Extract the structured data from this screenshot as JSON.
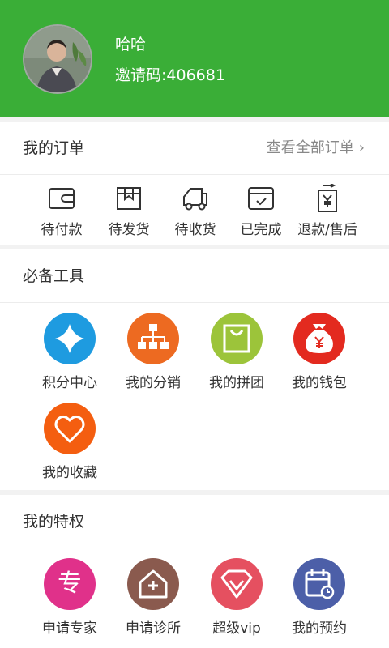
{
  "user": {
    "name": "哈哈",
    "invite_text": "邀请码:406681"
  },
  "orders": {
    "title": "我的订单",
    "view_all": "查看全部订单",
    "items": [
      {
        "label": "待付款",
        "icon": "wallet-icon"
      },
      {
        "label": "待发货",
        "icon": "package-icon"
      },
      {
        "label": "待收货",
        "icon": "truck-icon"
      },
      {
        "label": "已完成",
        "icon": "completed-icon"
      },
      {
        "label": "退款/售后",
        "icon": "refund-icon"
      }
    ]
  },
  "tools": {
    "title": "必备工具",
    "items": [
      {
        "label": "积分中心",
        "icon": "star-icon",
        "color": "#1e9be0"
      },
      {
        "label": "我的分销",
        "icon": "hierarchy-icon",
        "color": "#ed6a21"
      },
      {
        "label": "我的拼团",
        "icon": "shopping-bag-icon",
        "color": "#9cc43a"
      },
      {
        "label": "我的钱包",
        "icon": "money-bag-icon",
        "color": "#e32a1f"
      },
      {
        "label": "我的收藏",
        "icon": "heart-icon",
        "color": "#f45e10"
      }
    ]
  },
  "privileges": {
    "title": "我的特权",
    "items": [
      {
        "label": "申请专家",
        "icon": "expert-icon",
        "glyph": "专",
        "color": "#e0318a"
      },
      {
        "label": "申请诊所",
        "icon": "clinic-icon",
        "color": "#8a5a4e"
      },
      {
        "label": "超级vip",
        "icon": "diamond-icon",
        "color": "#e55060"
      },
      {
        "label": "我的预约",
        "icon": "calendar-icon",
        "color": "#4c5fa8"
      }
    ]
  }
}
